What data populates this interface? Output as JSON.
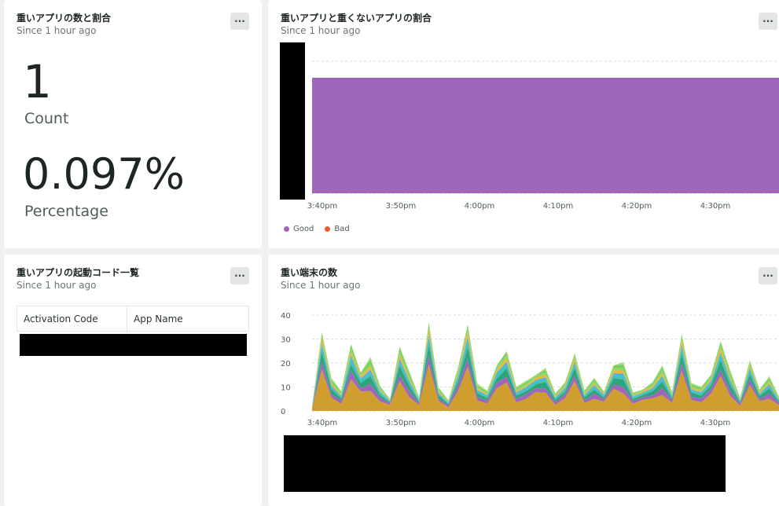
{
  "widgets": {
    "count_pct": {
      "title": "重いアプリの数と割合",
      "subtitle": "Since 1 hour ago",
      "count_value": "1",
      "count_label": "Count",
      "pct_value": "0.097%",
      "pct_label": "Percentage",
      "menu_label": "···"
    },
    "ratio_chart": {
      "title": "重いアプリと重くないアプリの割合",
      "subtitle": "Since 1 hour ago",
      "menu_label": "···",
      "x_ticks": [
        "3:40pm",
        "3:50pm",
        "4:00pm",
        "4:10pm",
        "4:20pm",
        "4:30pm"
      ],
      "legend": [
        {
          "label": "Good",
          "color": "#a066bc"
        },
        {
          "label": "Bad",
          "color": "#f05a35"
        }
      ]
    },
    "code_table": {
      "title": "重いアプリの起動コード一覧",
      "subtitle": "Since 1 hour ago",
      "menu_label": "···",
      "columns": [
        "Activation Code",
        "App Name"
      ]
    },
    "device_chart": {
      "title": "重い端末の数",
      "subtitle": "Since 1 hour ago",
      "menu_label": "···",
      "y_ticks": [
        "40",
        "30",
        "20",
        "10",
        "0"
      ],
      "x_ticks": [
        "3:40pm",
        "3:50pm",
        "4:00pm",
        "4:10pm",
        "4:20pm",
        "4:30pm"
      ]
    }
  },
  "chart_data": [
    {
      "type": "area",
      "series": [
        {
          "name": "Good",
          "color": "#a066bc"
        },
        {
          "name": "Bad",
          "color": "#f05a35"
        }
      ],
      "x": [
        "3:40pm",
        "3:50pm",
        "4:00pm",
        "4:10pm",
        "4:20pm",
        "4:30pm"
      ],
      "stacked": true,
      "grid": true,
      "legend": "bottom-left"
    },
    {
      "type": "area",
      "stacked": true,
      "x": [
        "3:40pm",
        "3:50pm",
        "4:00pm",
        "4:10pm",
        "4:20pm",
        "4:30pm"
      ],
      "ylim": [
        0,
        40
      ],
      "y_ticks": [
        0,
        10,
        20,
        30,
        40
      ],
      "grid": true,
      "totals": [
        2,
        33,
        14,
        9,
        28,
        16,
        24,
        11,
        5,
        27,
        18,
        6,
        37,
        10,
        5,
        18,
        36,
        12,
        9,
        19,
        25,
        11,
        13,
        15,
        18,
        8,
        12,
        24,
        9,
        15,
        8,
        19,
        22,
        8,
        9,
        12,
        21,
        8,
        32,
        12,
        11,
        15,
        29,
        18,
        6,
        21,
        9,
        16,
        6
      ],
      "layer_colors": [
        "#cf9e2e",
        "#a066bc",
        "#2fa37c",
        "#3ec4b9",
        "#4fb3e0",
        "#f0b63a",
        "#94d46a",
        "#7bd05d",
        "#a6e07a"
      ]
    }
  ]
}
